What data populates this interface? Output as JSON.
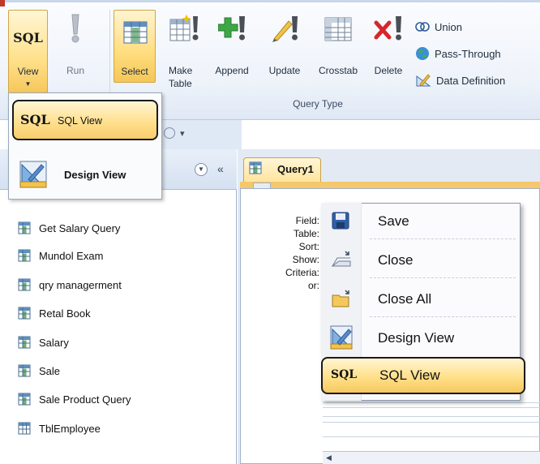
{
  "ribbon": {
    "view_top_label": "SQL",
    "view_label": "View",
    "run_label": "Run",
    "select_label": "Select",
    "make_table_line1": "Make",
    "make_table_line2": "Table",
    "append_label": "Append",
    "update_label": "Update",
    "crosstab_label": "Crosstab",
    "delete_label": "Delete",
    "union_label": "Union",
    "passthrough_label": "Pass-Through",
    "datadef_label": "Data Definition",
    "group_label": "Query Type"
  },
  "view_menu": {
    "items": [
      {
        "badge": "SQL",
        "label": "SQL View"
      },
      {
        "label": "Design View"
      }
    ]
  },
  "nav": {
    "items": [
      "Get Salary Query",
      "Mundol Exam",
      "qry managerment",
      "Retal Book",
      "Salary",
      "Sale",
      "Sale Product Query",
      "TblEmployee"
    ]
  },
  "document": {
    "tab_label": "Query1",
    "grid_labels": [
      "Field:",
      "Table:",
      "Sort:",
      "Show:",
      "Criteria:",
      "or:"
    ]
  },
  "context_menu": {
    "items": [
      {
        "label": "Save",
        "icon": "save-icon"
      },
      {
        "label": "Close",
        "icon": "close-icon"
      },
      {
        "label": "Close All",
        "icon": "close-all-icon"
      },
      {
        "label": "Design View",
        "icon": "design-view-icon"
      },
      {
        "badge": "SQL",
        "label": "SQL View"
      }
    ]
  }
}
